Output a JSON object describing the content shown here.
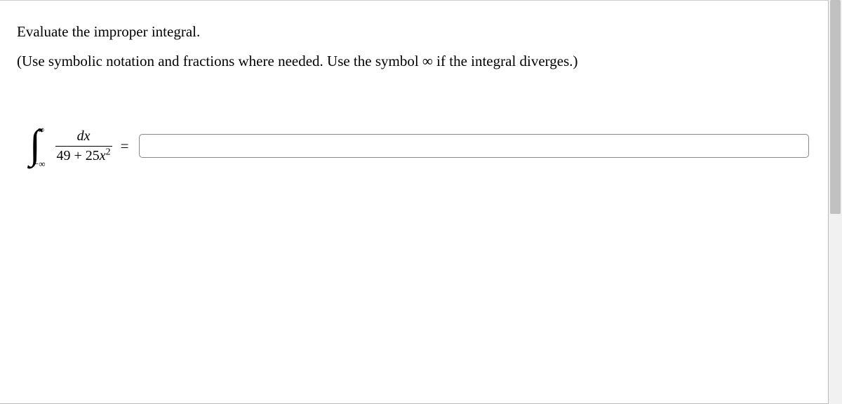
{
  "question": {
    "prompt": "Evaluate the improper integral.",
    "instruction": "(Use symbolic notation and fractions where needed. Use the symbol ∞ if the integral diverges.)"
  },
  "integral": {
    "upper_limit": "∞",
    "lower_limit": "−∞",
    "numerator": "dx",
    "denom_const": "49 + 25",
    "denom_var": "x",
    "equals": "="
  },
  "answer_value": ""
}
